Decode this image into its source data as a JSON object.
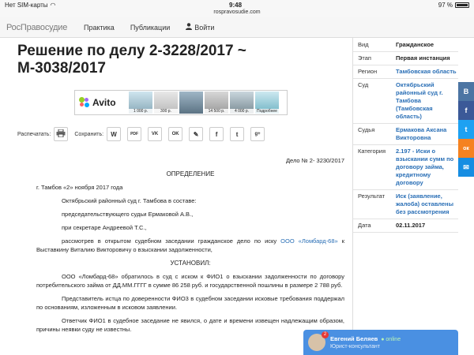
{
  "status_bar": {
    "carrier": "Нет SIM-карты",
    "time": "9:48",
    "battery": "97 %"
  },
  "url": "rospravosudie.com",
  "nav": {
    "logo": "РосПравосудие",
    "items": [
      "Практика",
      "Публикации"
    ],
    "login": "Войти"
  },
  "page_title": "Решение по делу 2-3228/2017 ~ М-3038/2017",
  "ad": {
    "brand": "Avito",
    "thumbs": [
      {
        "price": "1 000 р."
      },
      {
        "price": "300 р."
      },
      {
        "price": ""
      },
      {
        "price": "14 500 р."
      },
      {
        "price": "4 000 р."
      },
      {
        "price": "Подробнее"
      }
    ]
  },
  "tools": {
    "print_label": "Распечатать:",
    "save_label": "Сохранить:",
    "buttons": [
      "W",
      "PDF",
      "VK",
      "OK",
      "✎",
      "f",
      "t",
      "g+"
    ]
  },
  "document": {
    "case_no": "Дело № 2- 3230/2017",
    "heading": "ОПРЕДЕЛЕНИЕ",
    "place_date": "г. Тамбов «2» ноября 2017 года",
    "p1": "Октябрьский районный суд г. Тамбова в составе:",
    "p2": "председательствующего судьи Ермаковой А.В.,",
    "p3": "при секретаре Андреевой Т.С.,",
    "p4_before": "рассмотрев в открытом судебном заседании гражданское дело по иску ",
    "p4_link": "ООО «Ломбард-68»",
    "p4_after": " к Выставкину Виталию Викторовичу о взыскании задолженности,",
    "established": "УСТАНОВИЛ:",
    "p5": "ООО «Ломбард-68» обратилось в суд с иском к ФИО1 о взыскании задолженности по договору потребительского займа от ДД.ММ.ГГГГ в сумме 86 258 руб. и государственной пошлины в размере 2 788 руб.",
    "p6": "Представитель истца по доверенности ФИО3 в судебном заседании исковые требования поддержал по основаниям, изложенным в исковом заявлении.",
    "p7": "Ответчик ФИО1 в судебное заседание не явился, о дате и времени извещен надлежащим образом, причины неявки суду не известны."
  },
  "side_table": [
    {
      "key": "Вид",
      "value": "Гражданское",
      "link": false
    },
    {
      "key": "Этап",
      "value": "Первая инстанция",
      "link": false
    },
    {
      "key": "Регион",
      "value": "Тамбовская область",
      "link": true
    },
    {
      "key": "Суд",
      "value": "Октябрьский районный суд г. Тамбова (Тамбовская область)",
      "link": true
    },
    {
      "key": "Судья",
      "value": "Ермакова Аксана Викторовна",
      "link": true
    },
    {
      "key": "Категория",
      "value": "2.197 - Иски о взыскании сумм по договору займа, кредитному договору",
      "link": true
    },
    {
      "key": "Результат",
      "value": "Иск (заявление, жалоба) оставлены без рассмотрения",
      "link": true
    },
    {
      "key": "Дата",
      "value": "02.11.2017",
      "link": false
    }
  ],
  "social": [
    {
      "icon": "vk-icon",
      "glyph": "В",
      "color": "#4c75a3"
    },
    {
      "icon": "facebook-icon",
      "glyph": "f",
      "color": "#3b5998"
    },
    {
      "icon": "twitter-icon",
      "glyph": "t",
      "color": "#1da1f2"
    },
    {
      "icon": "odnoklassniki-icon",
      "glyph": "ок",
      "color": "#f58220"
    },
    {
      "icon": "mail-icon",
      "glyph": "✉",
      "color": "#168de2"
    }
  ],
  "chat": {
    "name": "Евгений Беляев",
    "status": "● online",
    "role": "Юрист-консультант",
    "badge": "2"
  }
}
